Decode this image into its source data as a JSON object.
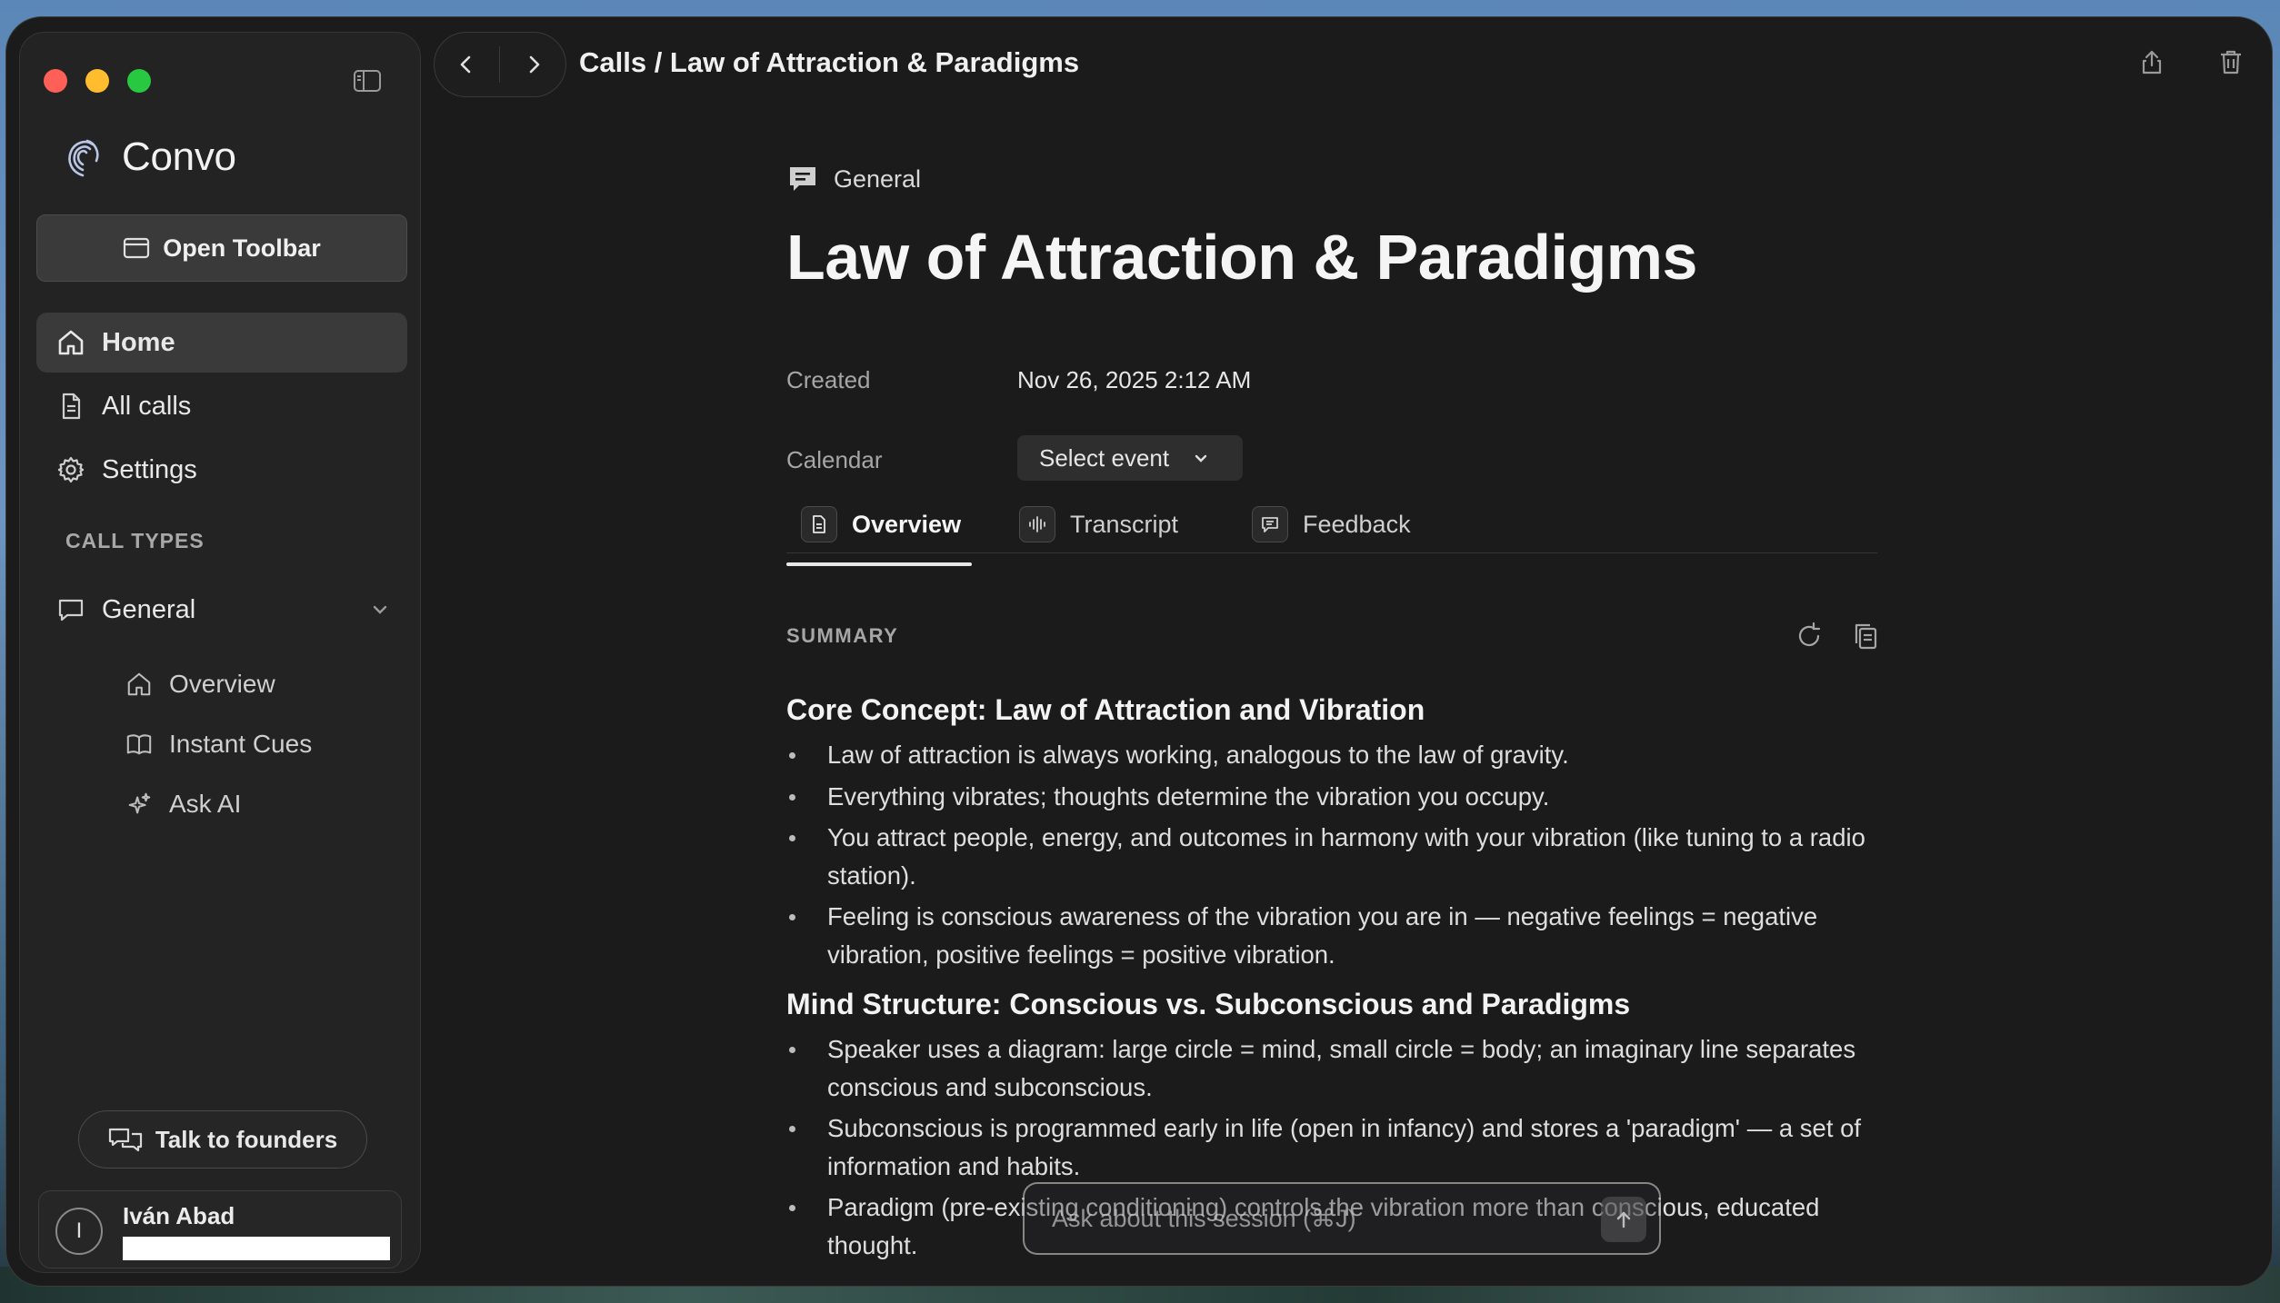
{
  "window": {
    "sidebar": {
      "brand": "Convo",
      "open_toolbar_label": "Open Toolbar",
      "nav": [
        {
          "label": "Home",
          "icon": "home-icon",
          "active": true
        },
        {
          "label": "All calls",
          "icon": "document-icon"
        },
        {
          "label": "Settings",
          "icon": "gear-icon"
        }
      ],
      "section_label": "CALL TYPES",
      "call_type": {
        "label": "General",
        "icon": "chat-bubble-icon",
        "expanded": true
      },
      "sub_items": [
        {
          "label": "Overview",
          "icon": "home-icon"
        },
        {
          "label": "Instant Cues",
          "icon": "book-icon"
        },
        {
          "label": "Ask AI",
          "icon": "sparkle-icon"
        }
      ],
      "talk_to_founders_label": "Talk to founders",
      "user": {
        "initial": "I",
        "name": "Iván Abad"
      }
    },
    "topbar": {
      "breadcrumb": "Calls / Law of Attraction & Paradigms"
    },
    "main": {
      "call_type_tag": "General",
      "title": "Law of Attraction & Paradigms",
      "created_label": "Created",
      "created_value": "Nov 26, 2025 2:12 AM",
      "calendar_label": "Calendar",
      "calendar_select": "Select event",
      "tabs": [
        {
          "label": "Overview",
          "active": true
        },
        {
          "label": "Transcript"
        },
        {
          "label": "Feedback"
        }
      ],
      "summary_label": "SUMMARY",
      "sections": [
        {
          "heading": "Core Concept: Law of Attraction and Vibration",
          "bullets": [
            "Law of attraction is always working, analogous to the law of gravity.",
            "Everything vibrates; thoughts determine the vibration you occupy.",
            "You attract people, energy, and outcomes in harmony with your vibration (like tuning to a radio station).",
            "Feeling is conscious awareness of the vibration you are in — negative feelings = negative vibration, positive feelings = positive vibration."
          ]
        },
        {
          "heading": "Mind Structure: Conscious vs. Subconscious and Paradigms",
          "bullets": [
            "Speaker uses a diagram: large circle = mind, small circle = body; an imaginary line separates conscious and subconscious.",
            "Subconscious is programmed early in life (open in infancy) and stores a 'paradigm' — a set of information and habits.",
            "Paradigm (pre-existing conditioning) controls the vibration more than conscious, educated thought."
          ]
        }
      ],
      "ask_placeholder": "Ask about this session (⌘J)"
    }
  },
  "colors": {
    "window_bg": "#1b1b1c",
    "sidebar_bg": "#232324",
    "traffic_red": "#fe5f57",
    "traffic_yellow": "#febc2e",
    "traffic_green": "#28c840"
  }
}
